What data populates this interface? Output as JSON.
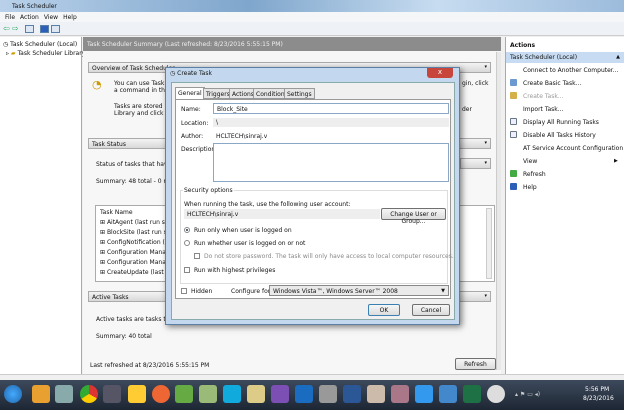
{
  "window": {
    "title": "Task Scheduler"
  },
  "menu": [
    "File",
    "Action",
    "View",
    "Help"
  ],
  "tree": {
    "root": "Task Scheduler (Local)",
    "child": "Task Scheduler Library"
  },
  "center": {
    "header": "Task Scheduler Summary (Last refreshed: 8/23/2016 5:55:15 PM)",
    "overview_title": "Overview of Task Scheduler",
    "overview_line1": "You can use Task Sch",
    "overview_line2": "a command in the A",
    "overview_line1_end": "gin, click",
    "overview_line3": "Tasks are stored in fo",
    "overview_line4": "Library and click on a",
    "overview_line3_end": "der",
    "status_title": "Task Status",
    "status_text": "Status of tasks that have star",
    "status_summary": "Summary: 48 total - 0 runnin",
    "task_name_header": "Task Name",
    "tasks": [
      "AitAgent (last run succe",
      "BlockSite (last run succe",
      "ConfigNotification (last",
      "Configuration Manager",
      "Configuration Manager",
      "CreateUpdate (last run"
    ],
    "active_title": "Active Tasks",
    "active_text": "Active tasks are tasks that a",
    "active_summary": "Summary: 40 total",
    "last_refreshed": "Last refreshed at 8/23/2016 5:55:15 PM",
    "refresh_button": "Refresh"
  },
  "actions": {
    "header": "Actions",
    "section": "Task Scheduler (Local)",
    "items": [
      "Connect to Another Computer...",
      "Create Basic Task...",
      "Create Task...",
      "Import Task...",
      "Display All Running Tasks",
      "Disable All Tasks History",
      "AT Service Account Configuration",
      "View",
      "Refresh",
      "Help"
    ]
  },
  "dialog": {
    "title": "Create Task",
    "close": "x",
    "tabs": [
      "General",
      "Triggers",
      "Actions",
      "Conditions",
      "Settings"
    ],
    "name_label": "Name:",
    "name_value": "Block_Site",
    "location_label": "Location:",
    "location_value": "\\",
    "author_label": "Author:",
    "author_value": "HCLTECH\\sinraj.v",
    "description_label": "Description:",
    "security_title": "Security options",
    "account_prompt": "When running the task, use the following user account:",
    "account_value": "HCLTECH\\sinraj.v",
    "change_user_button": "Change User or Group...",
    "radio_logged_on": "Run only when user is logged on",
    "radio_whether": "Run whether user is logged on or not",
    "dont_store": "Do not store password.  The task will only have access to local computer resources.",
    "highest": "Run with highest privileges",
    "hidden": "Hidden",
    "configure_label": "Configure for:",
    "configure_value": "Windows Vista™, Windows Server™ 2008",
    "ok": "OK",
    "cancel": "Cancel"
  },
  "tray": {
    "time": "5:56 PM",
    "date": "8/23/2016"
  }
}
